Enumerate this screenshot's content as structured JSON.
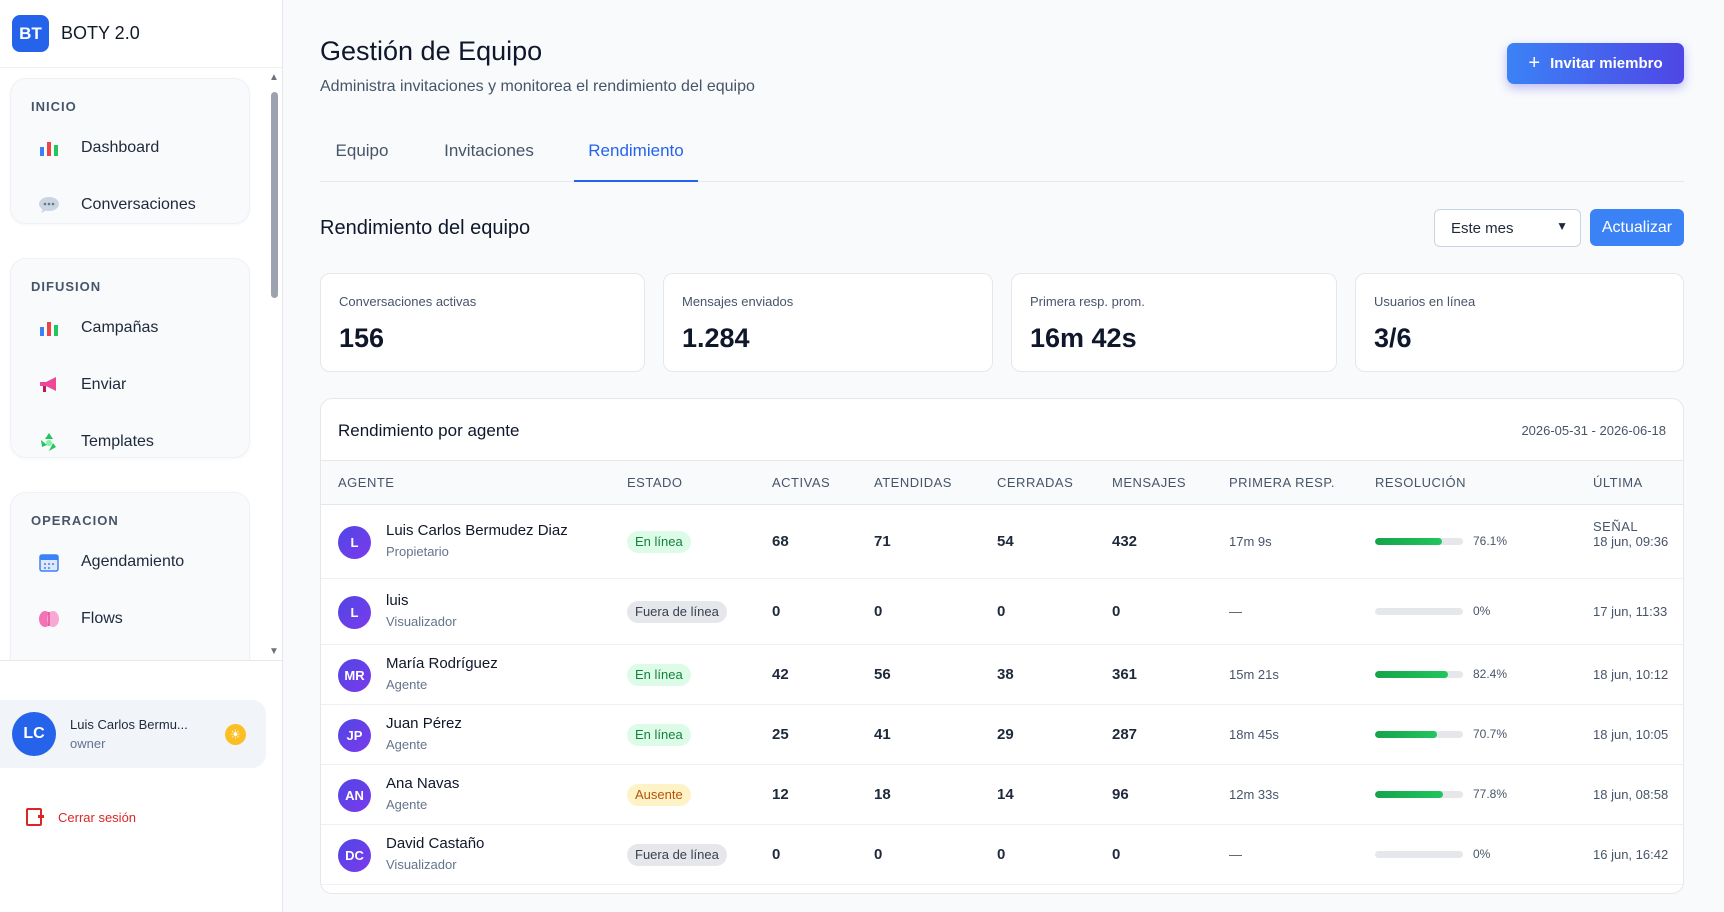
{
  "brand": {
    "logo": "BT",
    "name": "BOTY 2.0"
  },
  "sidebar": {
    "groups": [
      {
        "title": "INICIO",
        "items": [
          {
            "label": "Dashboard",
            "icon": "bar-chart-icon"
          },
          {
            "label": "Conversaciones",
            "icon": "chat-bubble-icon"
          }
        ]
      },
      {
        "title": "DIFUSION",
        "items": [
          {
            "label": "Campañas",
            "icon": "bar-chart-icon"
          },
          {
            "label": "Enviar",
            "icon": "megaphone-icon"
          },
          {
            "label": "Templates",
            "icon": "recycle-icon"
          }
        ]
      },
      {
        "title": "OPERACION",
        "items": [
          {
            "label": "Agendamiento",
            "icon": "calendar-icon"
          },
          {
            "label": "Flows",
            "icon": "brain-icon"
          }
        ]
      }
    ],
    "user": {
      "initials": "LC",
      "name": "Luis Carlos Bermu...",
      "role": "owner"
    },
    "logout_label": "Cerrar sesión"
  },
  "header": {
    "title": "Gestión de Equipo",
    "subtitle": "Administra invitaciones y monitorea el rendimiento del equipo",
    "invite_label": "Invitar miembro"
  },
  "tabs": [
    {
      "label": "Equipo",
      "active": false
    },
    {
      "label": "Invitaciones",
      "active": false
    },
    {
      "label": "Rendimiento",
      "active": true
    }
  ],
  "performance": {
    "title": "Rendimiento del equipo",
    "period_selected": "Este mes",
    "refresh_label": "Actualizar",
    "stats": [
      {
        "label": "Conversaciones activas",
        "value": "156"
      },
      {
        "label": "Mensajes enviados",
        "value": "1.284"
      },
      {
        "label": "Primera resp. prom.",
        "value": "16m 42s"
      },
      {
        "label": "Usuarios en línea",
        "value": "3/6"
      }
    ]
  },
  "agents_table": {
    "title": "Rendimiento por agente",
    "date_range": "2026-05-31 - 2026-06-18",
    "columns": [
      "AGENTE",
      "ESTADO",
      "ACTIVAS",
      "ATENDIDAS",
      "CERRADAS",
      "MENSAJES",
      "PRIMERA RESP.",
      "RESOLUCIÓN",
      "ÚLTIMA SEÑAL"
    ],
    "rows": [
      {
        "initials": "L",
        "name": "Luis Carlos Bermudez Diaz",
        "role": "Propietario",
        "status": "En línea",
        "status_type": "online",
        "activas": "68",
        "atendidas": "71",
        "cerradas": "54",
        "mensajes": "432",
        "primera": "17m 9s",
        "resolucion": "76.1%",
        "resolucion_value": 76.1,
        "ultima": "18 jun, 09:36"
      },
      {
        "initials": "L",
        "name": "luis",
        "role": "Visualizador",
        "status": "Fuera de línea",
        "status_type": "offline",
        "activas": "0",
        "atendidas": "0",
        "cerradas": "0",
        "mensajes": "0",
        "primera": "—",
        "resolucion": "0%",
        "resolucion_value": 0,
        "ultima": "17 jun, 11:33"
      },
      {
        "initials": "MR",
        "name": "María Rodríguez",
        "role": "Agente",
        "status": "En línea",
        "status_type": "online",
        "activas": "42",
        "atendidas": "56",
        "cerradas": "38",
        "mensajes": "361",
        "primera": "15m 21s",
        "resolucion": "82.4%",
        "resolucion_value": 82.4,
        "ultima": "18 jun, 10:12"
      },
      {
        "initials": "JP",
        "name": "Juan Pérez",
        "role": "Agente",
        "status": "En línea",
        "status_type": "online",
        "activas": "25",
        "atendidas": "41",
        "cerradas": "29",
        "mensajes": "287",
        "primera": "18m 45s",
        "resolucion": "70.7%",
        "resolucion_value": 70.7,
        "ultima": "18 jun, 10:05"
      },
      {
        "initials": "AN",
        "name": "Ana Navas",
        "role": "Agente",
        "status": "Ausente",
        "status_type": "away",
        "activas": "12",
        "atendidas": "18",
        "cerradas": "14",
        "mensajes": "96",
        "primera": "12m 33s",
        "resolucion": "77.8%",
        "resolucion_value": 77.8,
        "ultima": "18 jun, 08:58"
      },
      {
        "initials": "DC",
        "name": "David Castaño",
        "role": "Visualizador",
        "status": "Fuera de línea",
        "status_type": "offline",
        "activas": "0",
        "atendidas": "0",
        "cerradas": "0",
        "mensajes": "0",
        "primera": "—",
        "resolucion": "0%",
        "resolucion_value": 0,
        "ultima": "16 jun, 16:42"
      }
    ]
  }
}
